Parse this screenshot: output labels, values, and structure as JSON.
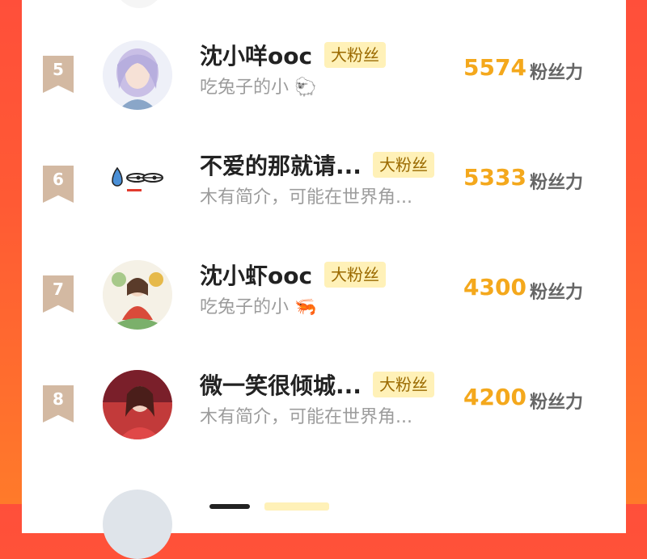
{
  "list": [
    {
      "rank": "5",
      "name": "沈小咩ooc",
      "badge": "大粉丝",
      "bio": "吃兔子的小",
      "bio_emoji": "🐑",
      "score": "5574",
      "unit": "粉丝力",
      "avatar": "anime-girl-avatar"
    },
    {
      "rank": "6",
      "name": "不爱的那就请...",
      "badge": "大粉丝",
      "bio": "木有简介，可能在世界角...",
      "bio_emoji": "",
      "score": "5333",
      "unit": "粉丝力",
      "avatar": "sweat-face-avatar"
    },
    {
      "rank": "7",
      "name": "沈小虾ooc",
      "badge": "大粉丝",
      "bio": "吃兔子的小",
      "bio_emoji": "🦐",
      "score": "4300",
      "unit": "粉丝力",
      "avatar": "painted-girl-avatar"
    },
    {
      "rank": "8",
      "name": "微一笑很倾城...",
      "badge": "大粉丝",
      "bio": "木有简介，可能在世界角...",
      "bio_emoji": "",
      "score": "4200",
      "unit": "粉丝力",
      "avatar": "woman-photo-avatar"
    }
  ],
  "colors": {
    "score": "#f4a81c",
    "badge_bg": "#fff1b8",
    "rank_bg": "#d3b9a2",
    "background": "#ff4f3a"
  }
}
